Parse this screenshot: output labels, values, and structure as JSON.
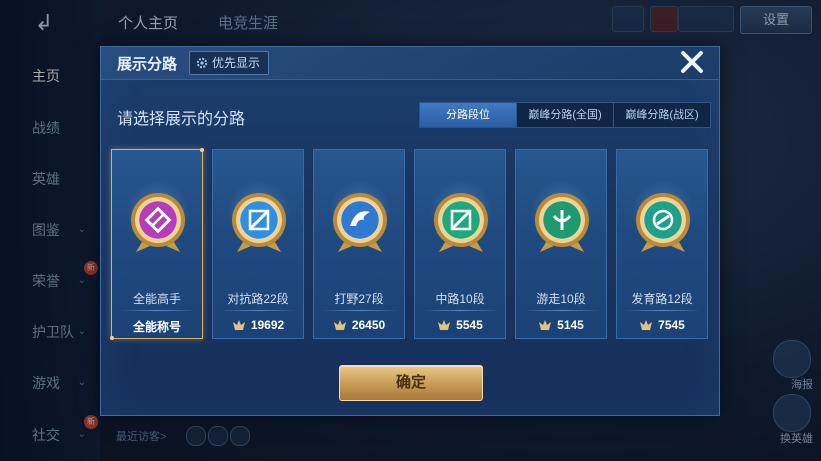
{
  "nav": {
    "items": [
      {
        "label": "主页",
        "active": true
      },
      {
        "label": "战绩",
        "active": false
      },
      {
        "label": "英雄",
        "active": false
      },
      {
        "label": "图鉴",
        "active": false
      },
      {
        "label": "荣誉",
        "active": false,
        "badge": "新"
      },
      {
        "label": "护卫队",
        "active": false
      },
      {
        "label": "游戏",
        "active": false
      },
      {
        "label": "社交",
        "active": false,
        "badge": "新"
      }
    ]
  },
  "top_tabs": [
    "个人主页",
    "电竞生涯"
  ],
  "top_right": {
    "button_label": "设置"
  },
  "side_labels": [
    "海报",
    "换英雄"
  ],
  "visitors_label": "最近访客>",
  "dialog": {
    "title": "展示分路",
    "priority_label": "优先显示",
    "subtitle": "请选择展示的分路",
    "segments": [
      {
        "label": "分路段位",
        "active": true
      },
      {
        "label": "巅峰分路(全国)",
        "active": false
      },
      {
        "label": "巅峰分路(战区)",
        "active": false
      }
    ],
    "cards": [
      {
        "name": "全能高手",
        "value": "全能称号",
        "emblem": "allround-emblem-icon",
        "color": "#b63db8",
        "selected": true,
        "show_icon": false
      },
      {
        "name": "对抗路22段",
        "value": "19692",
        "emblem": "clash-lane-emblem-icon",
        "color": "#2f8fe0",
        "selected": false,
        "show_icon": true
      },
      {
        "name": "打野27段",
        "value": "26450",
        "emblem": "jungle-emblem-icon",
        "color": "#2f7ad0",
        "selected": false,
        "show_icon": true
      },
      {
        "name": "中路10段",
        "value": "5545",
        "emblem": "mid-lane-emblem-icon",
        "color": "#1fa87a",
        "selected": false,
        "show_icon": true
      },
      {
        "name": "游走10段",
        "value": "5145",
        "emblem": "roam-emblem-icon",
        "color": "#1f9a6e",
        "selected": false,
        "show_icon": true
      },
      {
        "name": "发育路12段",
        "value": "7545",
        "emblem": "farm-lane-emblem-icon",
        "color": "#1fa08a",
        "selected": false,
        "show_icon": true
      }
    ],
    "confirm_label": "确定"
  },
  "colors": {
    "accent_gold": "#d9b26a",
    "panel_blue": "#1d3f6e",
    "segment_active": "#2a5ea4"
  }
}
